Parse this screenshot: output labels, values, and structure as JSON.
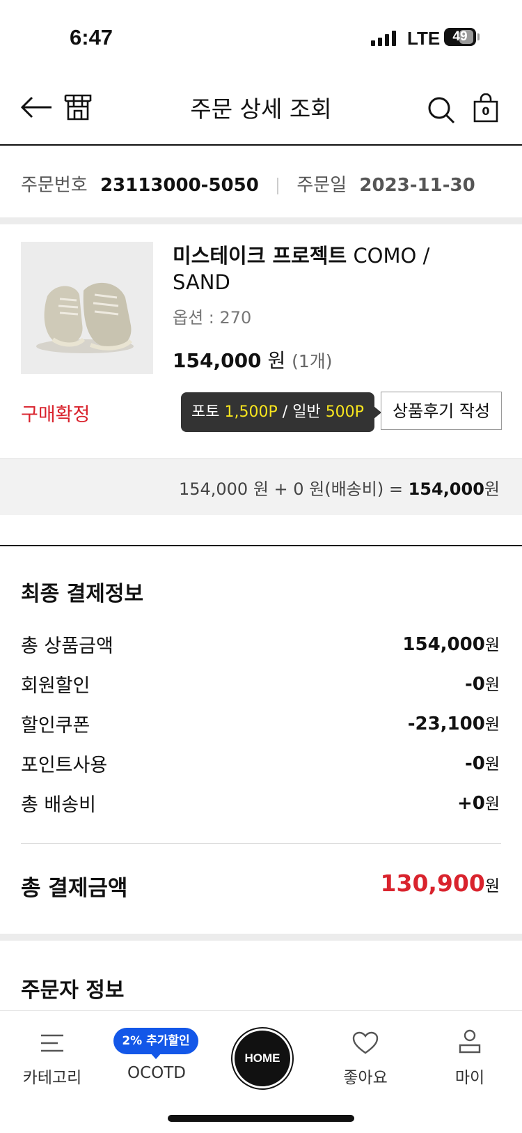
{
  "status_bar": {
    "time": "6:47",
    "network": "LTE",
    "battery": "49"
  },
  "header": {
    "title": "주문 상세 조회"
  },
  "order_meta": {
    "number_label": "주문번호",
    "number_value": "23113000-5050",
    "date_label": "주문일",
    "date_value": "2023-11-30"
  },
  "product": {
    "brand": "미스테이크 프로젝트",
    "name": "COMO / SAND",
    "option": "옵션 : 270",
    "price": "154,000",
    "price_unit": "원",
    "quantity": "(1개)",
    "status": "구매확정",
    "tooltip": {
      "photo_label": "포토",
      "photo_points": "1,500P",
      "sep": "/",
      "normal_label": "일반",
      "normal_points": "500P"
    },
    "review_button": "상품후기 작성"
  },
  "summary": {
    "text": "154,000 원 + 0 원(배송비) =",
    "total": "154,000",
    "unit": "원"
  },
  "payment": {
    "title": "최종 결제정보",
    "rows": [
      {
        "label": "총 상품금액",
        "value": "154,000"
      },
      {
        "label": "회원할인",
        "value": "-0"
      },
      {
        "label": "할인쿠폰",
        "value": "-23,100"
      },
      {
        "label": "포인트사용",
        "value": "-0"
      },
      {
        "label": "총 배송비",
        "value": "+0"
      }
    ],
    "unit": "원",
    "total_label": "총 결제금액",
    "total_value": "130,900",
    "highlight_color": "#d9232d"
  },
  "orderer": {
    "title": "주문자 정보"
  },
  "cart": {
    "count": "0"
  },
  "bottom_nav": {
    "items": [
      {
        "label": "카테고리",
        "icon": "menu-icon"
      },
      {
        "label": "OCOTD",
        "icon": "badge"
      },
      {
        "label": "HOME",
        "icon": "home-button"
      },
      {
        "label": "좋아요",
        "icon": "heart-icon"
      },
      {
        "label": "마이",
        "icon": "person-icon"
      }
    ],
    "badge": "2% 추가할인"
  }
}
